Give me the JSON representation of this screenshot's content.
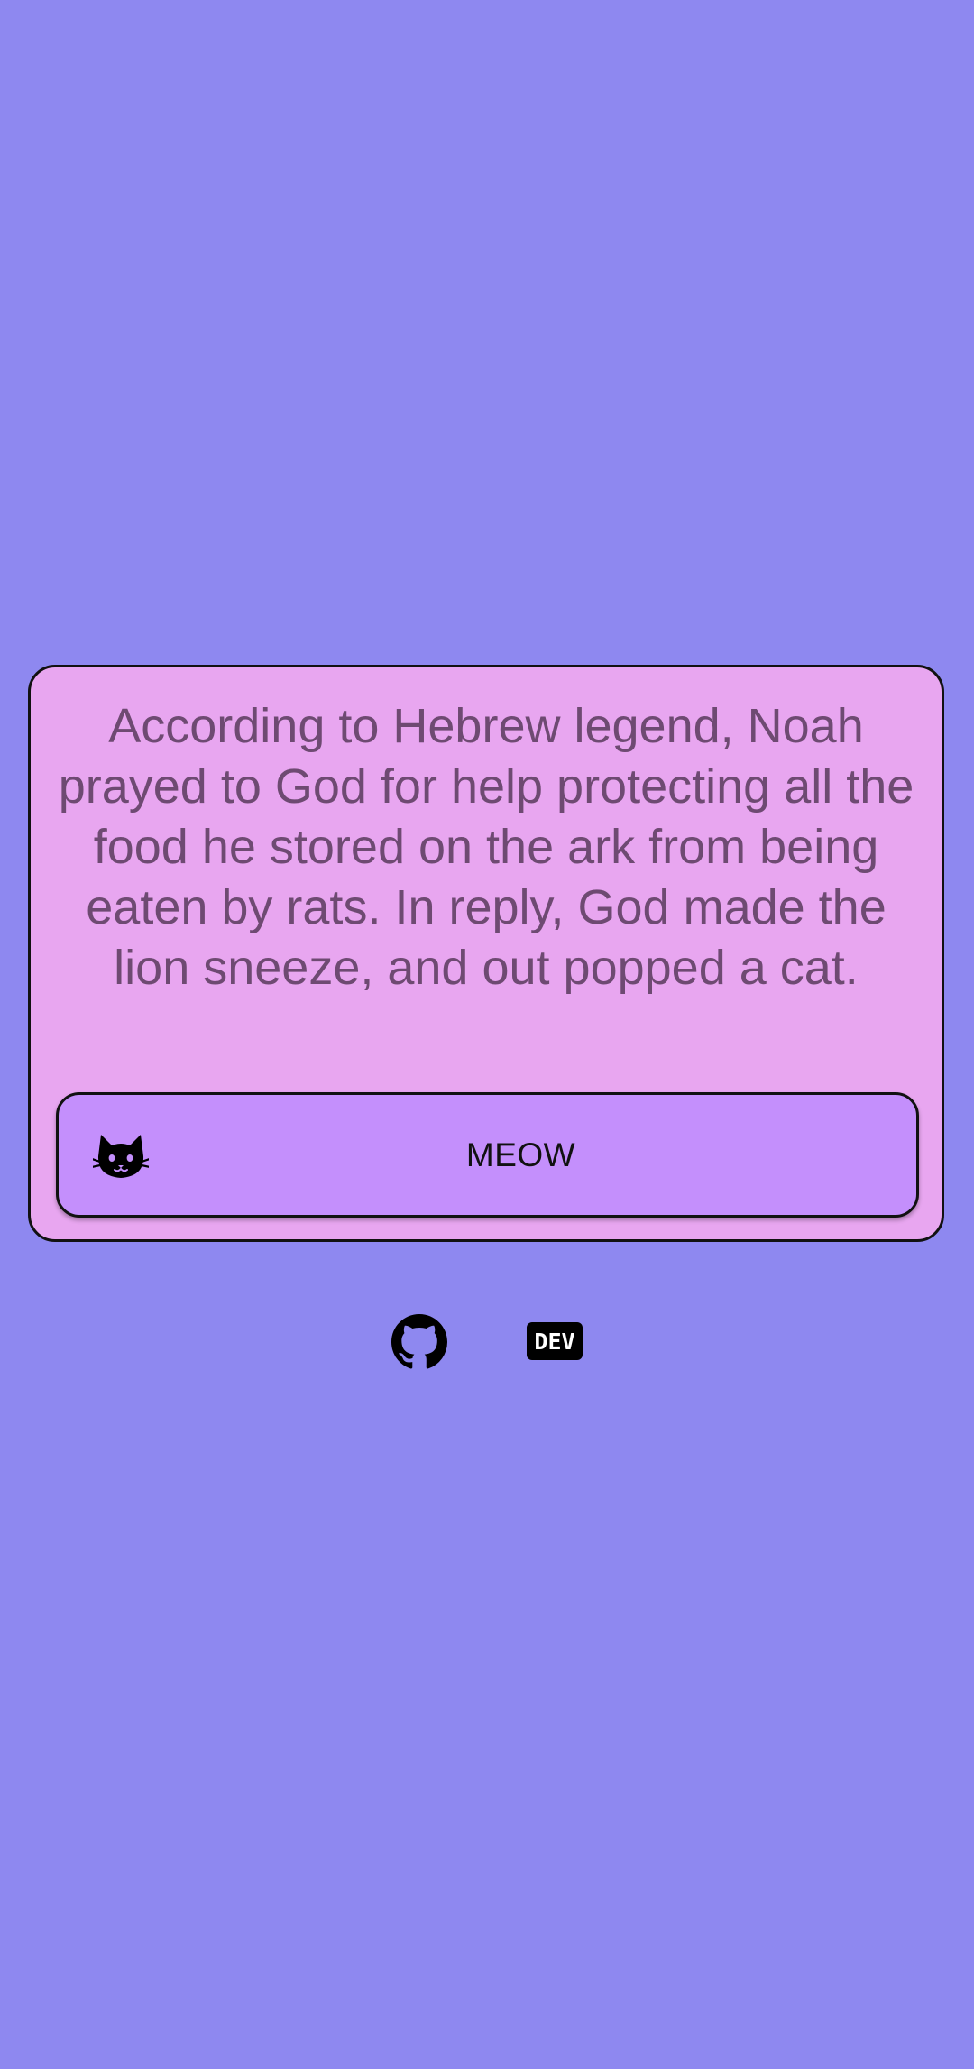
{
  "card": {
    "fact_text": "According to Hebrew legend, Noah prayed to God for help protecting all the food he stored on the ark from being eaten by rats. In reply, God made the lion sneeze, and out popped a cat."
  },
  "meow_button": {
    "label": "MEOW",
    "icon": "cat-icon"
  },
  "footer": {
    "links": [
      {
        "icon": "github-icon"
      },
      {
        "icon": "dev-icon",
        "label": "DEV"
      }
    ]
  },
  "colors": {
    "background": "#8e88f0",
    "card": "#e8a6f0",
    "button": "#c48ffc",
    "fact_text": "#6e4a72"
  }
}
